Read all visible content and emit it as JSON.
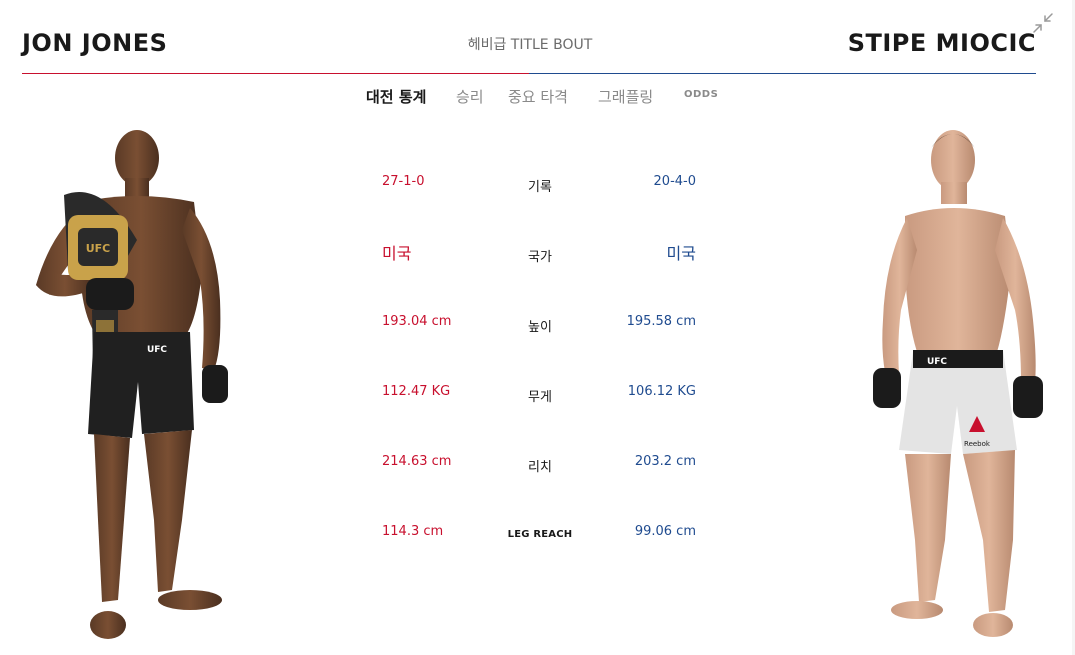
{
  "header": {
    "fighter_left": "JON JONES",
    "bout_title": "헤비급 TITLE BOUT",
    "fighter_right": "STIPE MIOCIC",
    "collapse_icon": "collapse-arrows-icon"
  },
  "colors": {
    "corner_red": "#c8102e",
    "corner_blue": "#1f4b8f",
    "text_dark": "#191919",
    "text_muted": "#8a8a8a"
  },
  "tabs": [
    {
      "label": "대전 통계",
      "active": true
    },
    {
      "label": "승리",
      "active": false
    },
    {
      "label": "중요 타격",
      "active": false
    },
    {
      "label": "그래플링",
      "active": false
    },
    {
      "label": "ODDS",
      "active": false
    }
  ],
  "stats": [
    {
      "label": "기록",
      "left": "27-1-0",
      "right": "20-4-0"
    },
    {
      "label": "국가",
      "left": "미국",
      "right": "미국"
    },
    {
      "label": "높이",
      "left": "193.04 cm",
      "right": "195.58 cm"
    },
    {
      "label": "무게",
      "left": "112.47 KG",
      "right": "106.12 KG"
    },
    {
      "label": "리치",
      "left": "214.63 cm",
      "right": "203.2 cm"
    },
    {
      "label": "LEG REACH",
      "left": "114.3 cm",
      "right": "99.06 cm"
    }
  ],
  "images": {
    "left_fighter_shorts": "UFC",
    "right_fighter_shorts": "UFC",
    "right_fighter_sponsor": "Reebok"
  }
}
